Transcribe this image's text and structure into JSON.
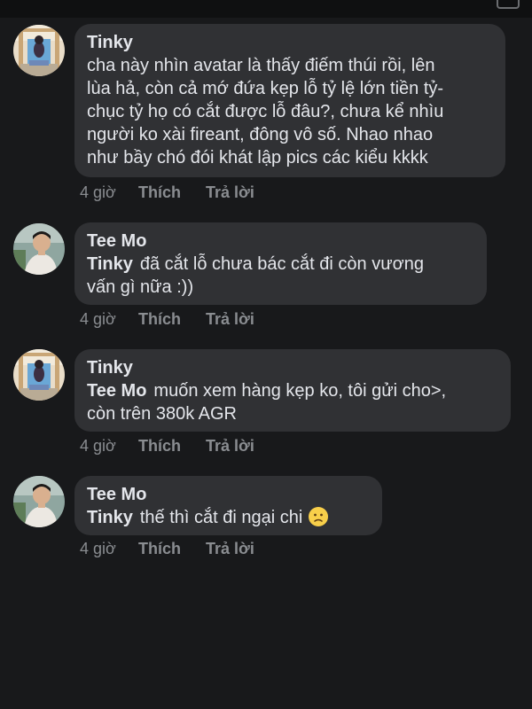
{
  "comments": [
    {
      "author": "Tinky",
      "mention": "",
      "lines": [
        "cha này nhìn avatar là thấy điếm thúi rồi, lên",
        "lùa hả, còn cả mớ đứa kẹp lỗ tỷ lệ lớn tiền tỷ-",
        "chục tỷ họ có cắt được lỗ đâu?, chưa kể nhìu",
        "người ko xài fireant, đông vô số. Nhao nhao",
        "như bầy chó đói khát lập pics các kiểu kkkk"
      ],
      "time": "4 giờ",
      "like": "Thích",
      "reply": "Trả lời"
    },
    {
      "author": "Tee Mo",
      "mention": "Tinky",
      "lines": [
        "đã cắt lỗ chưa bác cắt đi còn vương",
        "vấn gì nữa :))"
      ],
      "time": "4 giờ",
      "like": "Thích",
      "reply": "Trả lời"
    },
    {
      "author": "Tinky",
      "mention": "Tee Mo",
      "lines": [
        "muốn xem hàng kẹp ko, tôi gửi cho>,",
        "còn trên 380k AGR"
      ],
      "time": "4 giờ",
      "like": "Thích",
      "reply": "Trả lời"
    },
    {
      "author": "Tee Mo",
      "mention": "Tinky",
      "lines": [
        "thế thì cắt đi ngại chi"
      ],
      "emoji": "slightly-frowning-face-emoji",
      "time": "4 giờ",
      "like": "Thích",
      "reply": "Trả lời"
    }
  ]
}
